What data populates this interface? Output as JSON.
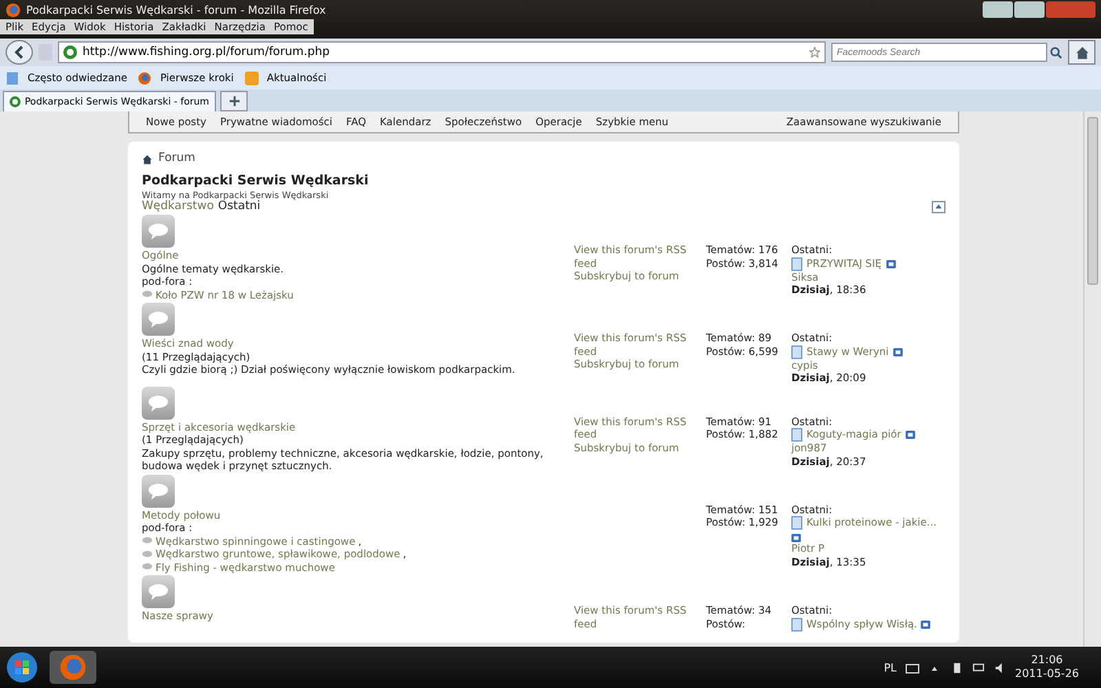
{
  "window": {
    "title": "Podkarpacki Serwis Wędkarski - forum - Mozilla Firefox"
  },
  "menu": [
    "Plik",
    "Edycja",
    "Widok",
    "Historia",
    "Zakładki",
    "Narzędzia",
    "Pomoc"
  ],
  "address_bar": {
    "value": "http://www.fishing.org.pl/forum/forum.php"
  },
  "search": {
    "placeholder": "Facemoods Search"
  },
  "bookmarks": [
    {
      "label": "Często odwiedzane",
      "kind": "page"
    },
    {
      "label": "Pierwsze kroki",
      "kind": "firefox"
    },
    {
      "label": "Aktualności",
      "kind": "feed"
    }
  ],
  "tabs": [
    {
      "label": "Podkarpacki Serwis Wędkarski - forum",
      "selected": true
    }
  ],
  "forum_nav": {
    "items": [
      "Nowe posty",
      "Prywatne wiadomości",
      "FAQ",
      "Kalendarz",
      "Społeczeństwo",
      "Operacje",
      "Szybkie menu"
    ],
    "search_link": "Zaawansowane wyszukiwanie"
  },
  "breadcrumb": "Forum",
  "site_title": "Podkarpacki Serwis Wędkarski",
  "welcome": "Witamy na Podkarpacki Serwis Wędkarski",
  "category": {
    "name": "Wędkarstwo",
    "last_header": "Ostatni"
  },
  "forums": [
    {
      "name": "Ogólne",
      "description": "Ogólne tematy wędkarskie.",
      "subforums_label": "pod-fora :",
      "subforums": [
        "Koło PZW nr 18 w Leżajsku"
      ],
      "rss": "View this forum's RSS feed",
      "subscribe": "Subskrybuj to forum",
      "topics": "Tematów: 176",
      "posts": "Postów: 3,814",
      "last_label": "Ostatni:",
      "last_title": "PRZYWITAJ SIĘ",
      "last_user": "Siksa",
      "last_date": "**Dzisiaj**, 18:36"
    },
    {
      "name": "Wieści znad wody",
      "viewers": "(11 Przeglądających)",
      "description": "Czyli gdzie biorą ;) Dział poświęcony wyłącznie łowiskom podkarpackim.",
      "rss": "View this forum's RSS feed",
      "subscribe": "Subskrybuj to forum",
      "topics": "Tematów: 89",
      "posts": "Postów: 6,599",
      "last_label": "Ostatni:",
      "last_title": "Stawy w Weryni",
      "last_user": "cypis",
      "last_date": "**Dzisiaj**, 20:09"
    },
    {
      "name": "Sprzęt i akcesoria wędkarskie",
      "viewers": "(1 Przeglądających)",
      "description": "Zakupy sprzętu, problemy techniczne, akcesoria wędkarskie, łodzie, pontony, budowa wędek i przynęt sztucznych.",
      "rss": "View this forum's RSS feed",
      "subscribe": "Subskrybuj to forum",
      "topics": "Tematów: 91",
      "posts": "Postów: 1,882",
      "last_label": "Ostatni:",
      "last_title": "Koguty-magia piór",
      "last_user": "jon987",
      "last_date": "**Dzisiaj**, 20:37"
    },
    {
      "name": "Metody połowu",
      "subforums_label": "pod-fora :",
      "subforums": [
        "Wędkarstwo spinningowe i castingowe",
        "Wędkarstwo gruntowe, spławikowe, podlodowe",
        "Fly Fishing - wędkarstwo muchowe"
      ],
      "subforum_separator": ",",
      "topics": "Tematów: 151",
      "posts": "Postów: 1,929",
      "last_label": "Ostatni:",
      "last_title": "Kulki proteinowe - jakie...",
      "last_user": "Piotr P",
      "last_date": "**Dzisiaj**, 13:35"
    },
    {
      "name": "Nasze sprawy",
      "rss": "View this forum's RSS feed",
      "topics": "Tematów: 34",
      "posts": "Postów:",
      "last_label": "Ostatni:",
      "last_title": "Wspólny spływ Wisłą."
    }
  ],
  "taskbar": {
    "language": "PL",
    "time": "21:06",
    "date": "2011-05-26"
  }
}
